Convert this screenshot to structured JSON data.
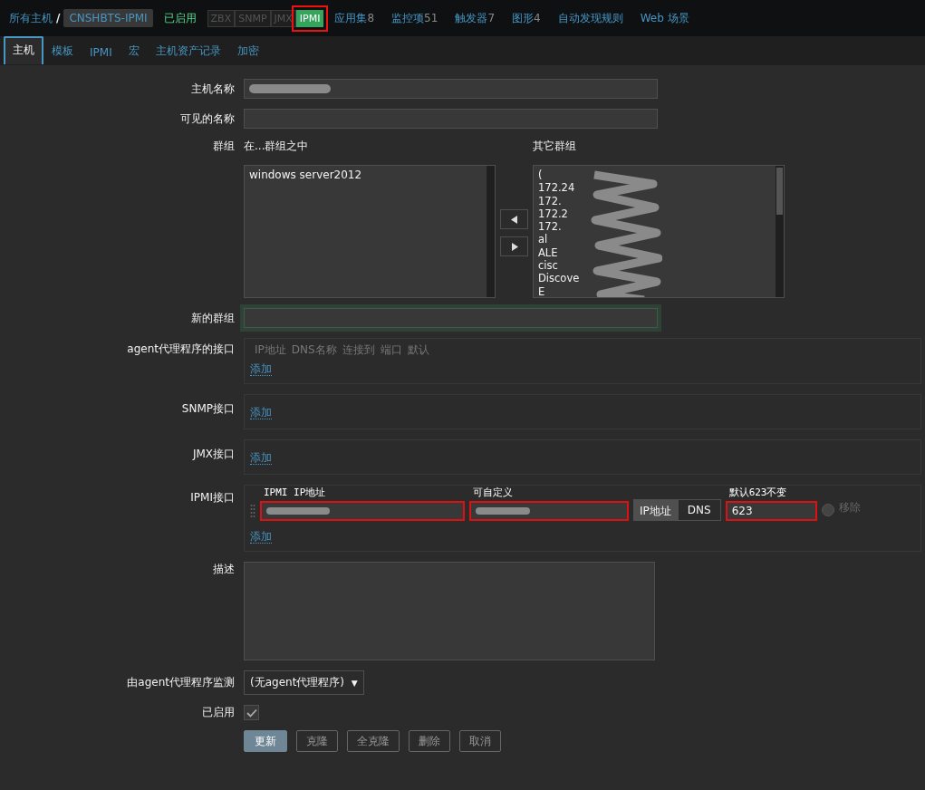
{
  "breadcrumb": {
    "root": "所有主机",
    "separator": "/",
    "host": "CNSHBTS-IPMI"
  },
  "status": "已启用",
  "availability": [
    {
      "label": "ZBX",
      "active": false,
      "highlighted": false
    },
    {
      "label": "SNMP",
      "active": false,
      "highlighted": false
    },
    {
      "label": "JMX",
      "active": false,
      "highlighted": false
    },
    {
      "label": "IPMI",
      "active": true,
      "highlighted": true
    }
  ],
  "links": [
    {
      "label": "应用集",
      "count": "8"
    },
    {
      "label": "监控项",
      "count": "51"
    },
    {
      "label": "触发器",
      "count": "7"
    },
    {
      "label": "图形",
      "count": "4"
    },
    {
      "label": "自动发现规则"
    },
    {
      "label": "Web 场景"
    }
  ],
  "tabs": [
    {
      "label": "主机",
      "selected": true
    },
    {
      "label": "模板",
      "selected": false
    },
    {
      "label": "IPMI",
      "selected": false
    },
    {
      "label": "宏",
      "selected": false
    },
    {
      "label": "主机资产记录",
      "selected": false
    },
    {
      "label": "加密",
      "selected": false
    }
  ],
  "form": {
    "host_name": {
      "label": "主机名称",
      "redacted": true
    },
    "visible_name": {
      "label": "可见的名称"
    },
    "groups": {
      "label": "群组",
      "in_label": "在...群组之中",
      "in_items": [
        "windows server2012"
      ],
      "other_label": "其它群组",
      "other_items": [
        "(",
        "172.24",
        "172.",
        "172.2",
        "172.",
        "al",
        "ALE",
        "cisc",
        "Discove",
        "E"
      ],
      "redacted": true
    },
    "new_group": {
      "label": "新的群组",
      "focused": true
    },
    "agent_interface": {
      "label": "agent代理程序的接口",
      "headers": [
        "IP地址",
        "DNS名称",
        "连接到",
        "端口",
        "默认"
      ],
      "add": "添加"
    },
    "snmp_interface": {
      "label": "SNMP接口",
      "add": "添加"
    },
    "jmx_interface": {
      "label": "JMX接口",
      "add": "添加"
    },
    "ipmi_interface": {
      "label": "IPMI接口",
      "ip_redacted": true,
      "dns_redacted": true,
      "connect_to": [
        {
          "label": "IP地址",
          "selected": true
        },
        {
          "label": "DNS",
          "selected": false
        }
      ],
      "port": "623",
      "default_selected": false,
      "remove": "移除",
      "add": "添加",
      "annotations": [
        "IPMI IP地址",
        "可自定义",
        "默认623不变"
      ]
    },
    "description": {
      "label": "描述"
    },
    "proxy": {
      "label": "由agent代理程序监测",
      "value": "(无agent代理程序)",
      "caret": "▼"
    },
    "enabled": {
      "label": "已启用",
      "checked": true
    }
  },
  "buttons": [
    {
      "label": "更新",
      "kind": "primary"
    },
    {
      "label": "克隆",
      "kind": "secondary"
    },
    {
      "label": "全克隆",
      "kind": "secondary"
    },
    {
      "label": "删除",
      "kind": "secondary"
    },
    {
      "label": "取消",
      "kind": "secondary"
    }
  ]
}
